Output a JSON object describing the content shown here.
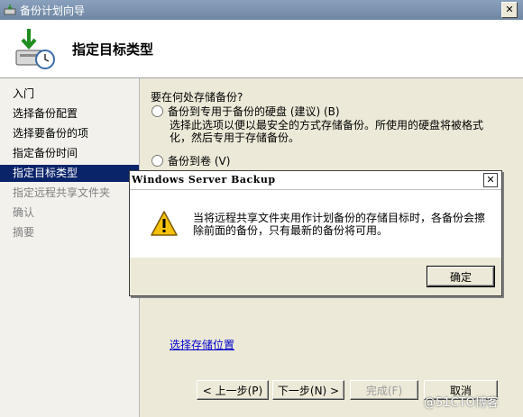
{
  "window": {
    "title": "备份计划向导",
    "close_glyph": "✕"
  },
  "header": {
    "title": "指定目标类型",
    "icon": "backup-wizard-icon"
  },
  "sidebar": {
    "items": [
      {
        "label": "入门",
        "state": "normal"
      },
      {
        "label": "选择备份配置",
        "state": "normal"
      },
      {
        "label": "选择要备份的项",
        "state": "normal"
      },
      {
        "label": "指定备份时间",
        "state": "normal"
      },
      {
        "label": "指定目标类型",
        "state": "active"
      },
      {
        "label": "指定远程共享文件夹",
        "state": "disabled"
      },
      {
        "label": "确认",
        "state": "disabled"
      },
      {
        "label": "摘要",
        "state": "disabled"
      }
    ]
  },
  "main": {
    "question": "要在何处存储备份?",
    "options": [
      {
        "label": "备份到专用于备份的硬盘 (建议) (B)",
        "selected": false
      },
      {
        "label": "备份到卷 (V)",
        "selected": false
      }
    ],
    "option1_desc": "选择此选项以便以最安全的方式存储备份。所使用的硬盘将被格式化，然后专用于存储备份。",
    "link": "选择存储位置"
  },
  "buttons": {
    "prev": "< 上一步(P)",
    "next": "下一步(N) >",
    "finish": "完成(F)",
    "cancel": "取消"
  },
  "dialog": {
    "title": "Windows Server Backup",
    "close_glyph": "✕",
    "message": "当将远程共享文件夹用作计划备份的存储目标时，各备份会擦除前面的备份，只有最新的备份将可用。",
    "ok": "确定",
    "icon": "warning-icon"
  },
  "watermark": "@51CTO博客"
}
